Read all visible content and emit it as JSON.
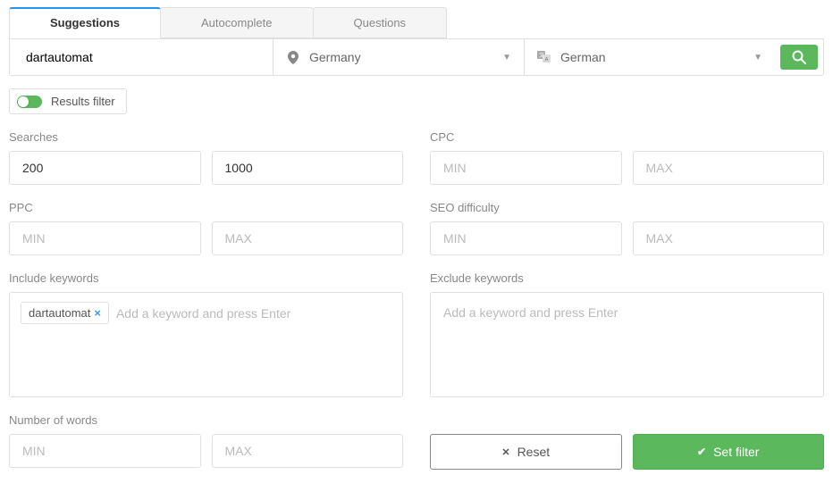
{
  "tabs": {
    "suggestions": "Suggestions",
    "autocomplete": "Autocomplete",
    "questions": "Questions"
  },
  "search": {
    "value": "dartautomat",
    "country": "Germany",
    "language": "German"
  },
  "filter_toggle": {
    "label": "Results filter"
  },
  "labels": {
    "searches": "Searches",
    "cpc": "CPC",
    "ppc": "PPC",
    "seo": "SEO difficulty",
    "include": "Include keywords",
    "exclude": "Exclude keywords",
    "numwords": "Number of words"
  },
  "placeholders": {
    "min": "MIN",
    "max": "MAX",
    "keyword": "Add a keyword and press Enter"
  },
  "values": {
    "searches_min": "200",
    "searches_max": "1000"
  },
  "include_tags": {
    "tag0": "dartautomat"
  },
  "buttons": {
    "reset": "Reset",
    "set": "Set filter"
  }
}
